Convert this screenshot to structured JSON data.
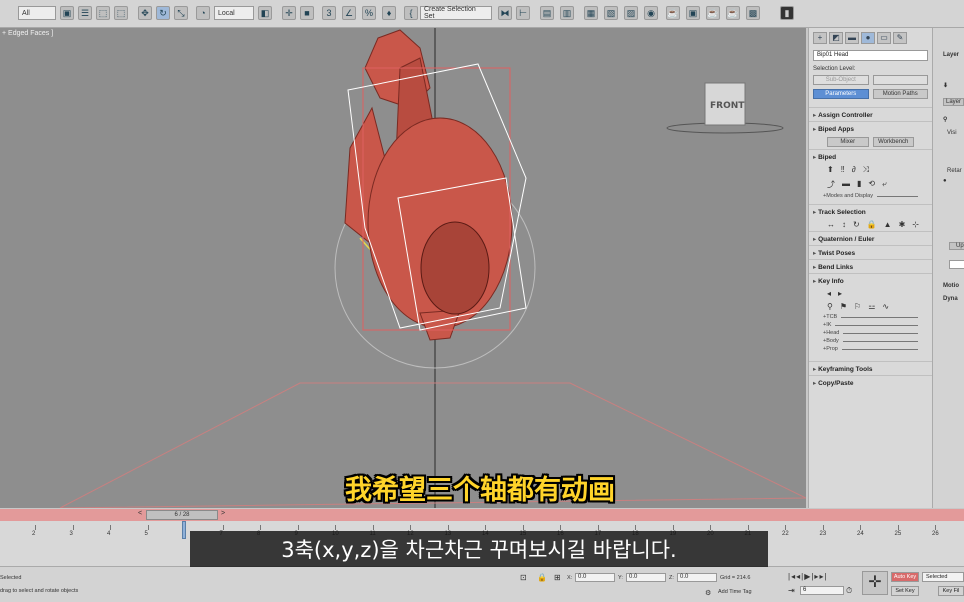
{
  "toolbar": {
    "filter_select": "All",
    "coord_select": "Local",
    "selection_set": "Create Selection Set"
  },
  "viewport": {
    "label": "+ Edged Faces ]",
    "viewcube_label": "FRONT"
  },
  "command_panel": {
    "object_name": "Bip01 Head",
    "selection_level_label": "Selection Level:",
    "sub_object_button": "Sub-Object",
    "parameters_button": "Parameters",
    "motion_paths_button": "Motion Paths",
    "rollouts": {
      "assign_controller": "Assign Controller",
      "biped_apps": "Biped Apps",
      "biped": "Biped",
      "track_selection": "Track Selection",
      "quaternion_euler": "Quaternion / Euler",
      "twist_poses": "Twist Poses",
      "bend_links": "Bend Links",
      "key_info": "Key Info",
      "keyframing_tools": "Keyframing Tools",
      "copy_paste": "Copy/Paste"
    },
    "mixer_button": "Mixer",
    "workbench_button": "Workbench",
    "modes_display_label": "+Modes and Display",
    "key_info_params": [
      "+TCB",
      "+IK",
      "+Head",
      "+Body",
      "+Prop"
    ]
  },
  "right_panel": {
    "layer_label": "Layer",
    "layer_button": "Layer",
    "visibility_label": "Visi",
    "retarget_label": "Retar",
    "update_button": "Up",
    "motion_label": "Motio",
    "dynamics_label": "Dyna"
  },
  "timeline": {
    "frame_display": "6 / 28",
    "prev_arrow": "<",
    "next_arrow": ">",
    "ticks": [
      "2",
      "3",
      "4",
      "5",
      "6",
      "7",
      "8",
      "9",
      "10",
      "11",
      "12",
      "13",
      "14",
      "15",
      "16",
      "17",
      "18",
      "19",
      "20",
      "21",
      "22",
      "23",
      "24",
      "25",
      "26"
    ]
  },
  "statusbar": {
    "selection_status": "Selected",
    "prompt": "drag to select and rotate objects",
    "x_label": "X:",
    "x_value": "0.0",
    "y_label": "Y:",
    "y_value": "0.0",
    "z_label": "Z:",
    "z_value": "0.0",
    "grid": "Grid = 214.6",
    "add_time_tag": "Add Time Tag",
    "auto_key": "Auto Key",
    "selected_dropdown": "Selected",
    "set_key": "Set Key",
    "key_filters": "Key Fil",
    "frame_field": "6"
  },
  "subtitles": {
    "chinese": "我希望三个轴都有动画",
    "korean": "3축(x,y,z)을 차근차근 꾸며보시길 바랍니다."
  },
  "colors": {
    "timeslider": "#e39a9a",
    "viewport_bg": "#8e8e8e",
    "model": "#c9574a",
    "subtitle_yellow": "#ffd42a",
    "active_button": "#5d8fd4"
  }
}
